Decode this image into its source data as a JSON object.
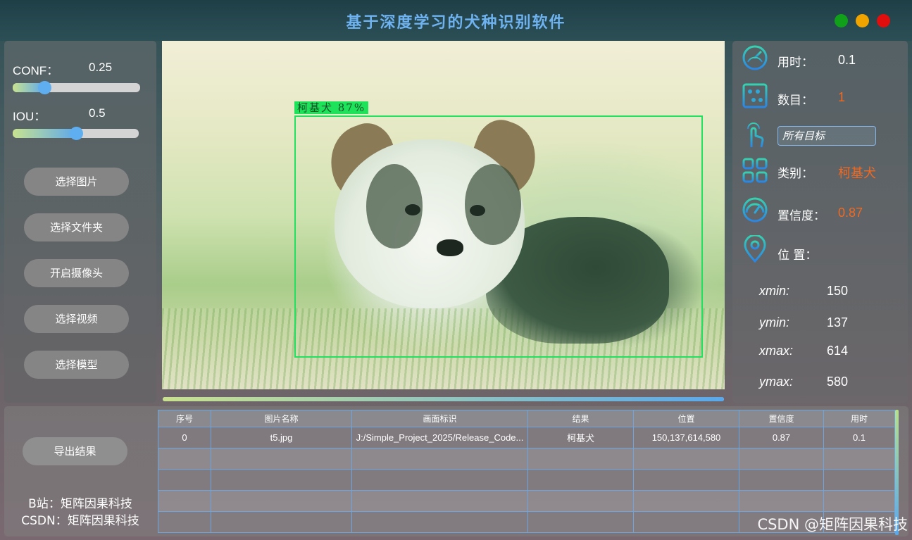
{
  "app": {
    "title": "基于深度学习的犬种识别软件"
  },
  "window_controls": {
    "green": "#11a01a",
    "yellow": "#f0a400",
    "red": "#e20e0e"
  },
  "conf": {
    "label": "CONF：",
    "value": "0.25",
    "fraction": 0.25
  },
  "iou": {
    "label": "IOU：",
    "value": "0.5",
    "fraction": 0.5
  },
  "buttons": {
    "select_image": "选择图片",
    "select_folder": "选择文件夹",
    "open_camera": "开启摄像头",
    "select_video": "选择视频",
    "select_model": "选择模型",
    "export": "导出结果"
  },
  "detection": {
    "label": "柯基犬 87%",
    "color": "#22e060"
  },
  "progress": {
    "fraction": 1.0
  },
  "info": {
    "time_label": "用时：",
    "time_value": "0.1",
    "count_label": "数目：",
    "count_value": "1",
    "target_select": "所有目标",
    "class_label": "类别：",
    "class_value": "柯基犬",
    "conf_label": "置信度：",
    "conf_value": "0.87",
    "pos_label": "位 置：",
    "xmin_label": "xmin:",
    "xmin_value": "150",
    "ymin_label": "ymin:",
    "ymin_value": "137",
    "xmax_label": "xmax:",
    "xmax_value": "614",
    "ymax_label": "ymax:",
    "ymax_value": "580"
  },
  "table": {
    "headers": [
      "序号",
      "图片名称",
      "画面标识",
      "结果",
      "位置",
      "置信度",
      "用时"
    ],
    "rows": [
      [
        "0",
        "t5.jpg",
        "J:/Simple_Project_2025/Release_Code...",
        "柯基犬",
        "150,137,614,580",
        "0.87",
        "0.1"
      ]
    ]
  },
  "credits": {
    "bilibili": "B站：矩阵因果科技",
    "csdn": "CSDN：矩阵因果科技"
  },
  "watermark": "CSDN @矩阵因果科技",
  "colors": {
    "accent": "#5faef0",
    "value_highlight": "#f06a23",
    "title": "#6fb2f0"
  },
  "icons": [
    "speedometer-icon",
    "abacus-icon",
    "touch-hand-icon",
    "grid-categories-icon",
    "gauge-icon",
    "location-pin-icon"
  ]
}
